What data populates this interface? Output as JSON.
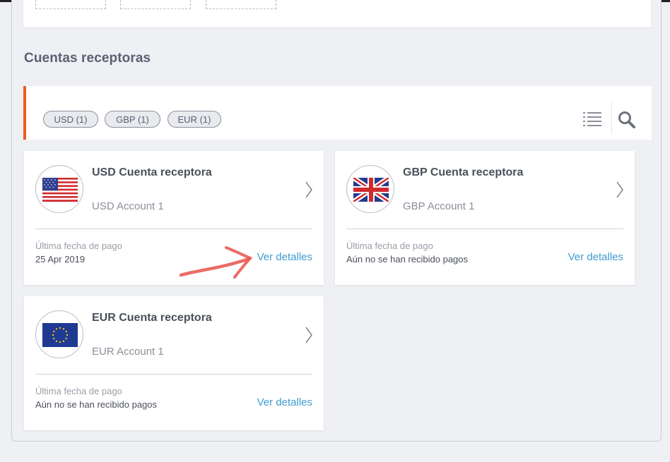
{
  "section_title": "Cuentas receptoras",
  "filters": [
    {
      "label": "USD (1)"
    },
    {
      "label": "GBP (1)"
    },
    {
      "label": "EUR (1)"
    }
  ],
  "toolbar": {
    "list_icon": "list-icon",
    "search_icon": "search-icon"
  },
  "accent_color": "#ee5a24",
  "link_color": "#3f9bd0",
  "cards": [
    {
      "flag": "us-flag-icon",
      "title": "USD Cuenta receptora",
      "subtitle": "",
      "account": "USD Account 1",
      "last_payment_label": "Última fecha de pago",
      "last_payment_value": "25 Apr 2019",
      "details_label": "Ver detalles"
    },
    {
      "flag": "uk-flag-icon",
      "title": "GBP Cuenta receptora",
      "subtitle": "",
      "account": "GBP Account 1",
      "last_payment_label": "Última fecha de pago",
      "last_payment_value": "Aún no se han recibido pagos",
      "details_label": "Ver detalles"
    },
    {
      "flag": "eu-flag-icon",
      "title": "EUR Cuenta receptora",
      "subtitle": "",
      "account": "EUR Account 1",
      "last_payment_label": "Última fecha de pago",
      "last_payment_value": "Aún no se han recibido pagos",
      "details_label": "Ver detalles"
    }
  ]
}
